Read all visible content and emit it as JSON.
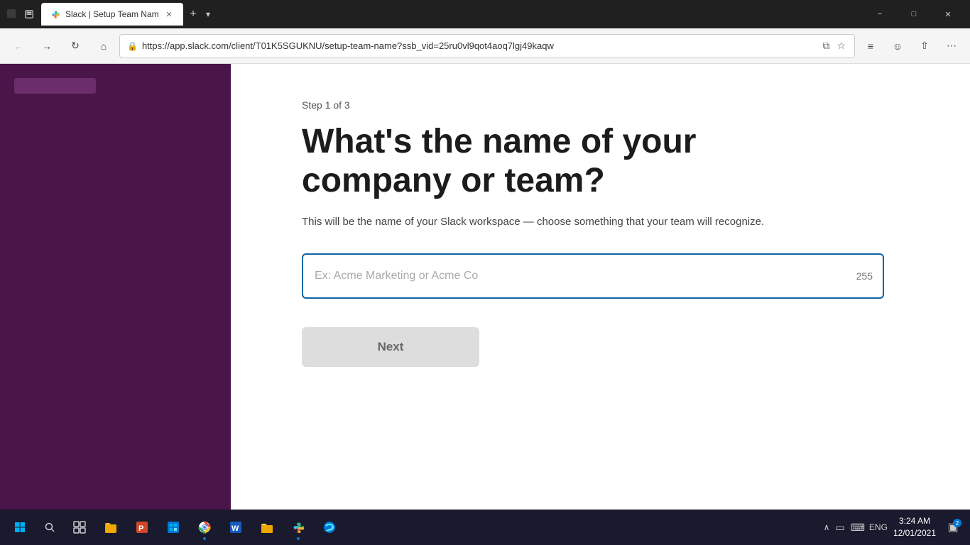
{
  "browser": {
    "titlebar": {
      "back_btn": "◀",
      "forward_btn": "▶",
      "reload_btn": "↻",
      "home_btn": "⌂"
    },
    "tab": {
      "title": "Slack | Setup Team Nam",
      "url": "https://app.slack.com/client/T01K5SGUKNU/setup-team-name?ssb_vid=25ru0vl9qot4aoq7lgj49kaqw"
    },
    "window_controls": {
      "minimize": "−",
      "maximize": "□",
      "close": "✕"
    }
  },
  "page": {
    "step_label": "Step 1 of 3",
    "heading": "What's the name of your company or team?",
    "subtext": "This will be the name of your Slack workspace — choose something that your team will recognize.",
    "input_placeholder": "Ex: Acme Marketing or Acme Co",
    "char_count": "255",
    "next_button": "Next"
  },
  "taskbar": {
    "start_label": "Start",
    "search_label": "Search",
    "apps": [
      {
        "name": "task-view",
        "label": "Task View"
      },
      {
        "name": "file-explorer",
        "label": "File Explorer"
      },
      {
        "name": "powerpoint",
        "label": "PowerPoint"
      },
      {
        "name": "microsoft-store",
        "label": "Microsoft Store"
      },
      {
        "name": "chrome",
        "label": "Chrome"
      },
      {
        "name": "word",
        "label": "Word"
      },
      {
        "name": "files",
        "label": "Files"
      },
      {
        "name": "slack",
        "label": "Slack"
      },
      {
        "name": "edge",
        "label": "Edge"
      }
    ],
    "system": {
      "lang": "ENG",
      "time": "3:24 AM",
      "date": "12/01/2021",
      "notification_count": "2"
    }
  }
}
